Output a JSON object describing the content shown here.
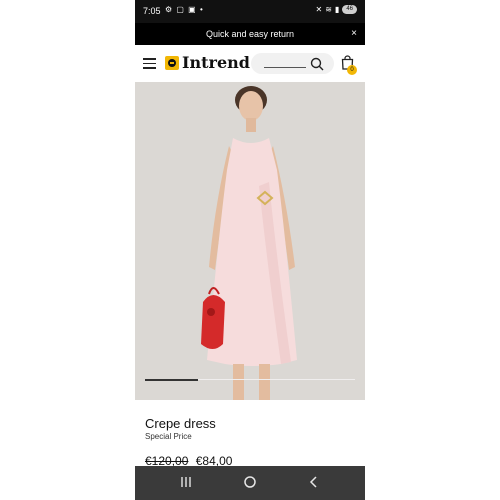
{
  "status": {
    "time": "7:05",
    "battery": "46"
  },
  "promo": {
    "text": "Quick and easy return",
    "close": "×"
  },
  "header": {
    "brand": "Intrend",
    "cart_count": "0"
  },
  "product": {
    "name": "Crepe dress",
    "subtitle": "Special Price",
    "old_price": "€120,00",
    "new_price": "€84,00",
    "gallery_progress": 0.25
  },
  "colors": {
    "accent": "#f2b705",
    "dress": "#f6dcdc",
    "bag": "#d42a2a"
  }
}
